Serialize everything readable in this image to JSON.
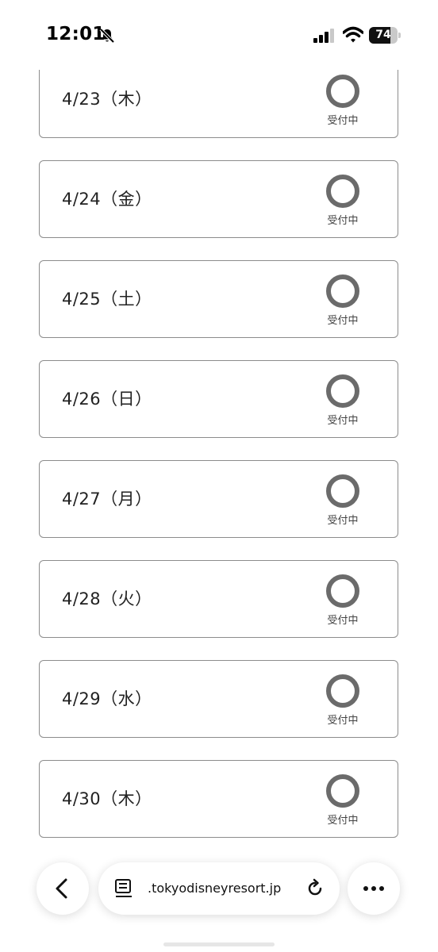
{
  "status_bar": {
    "time": "12:01",
    "battery_level": "74"
  },
  "days": [
    {
      "date": "4/23（木）",
      "status": "受付中"
    },
    {
      "date": "4/24（金）",
      "status": "受付中"
    },
    {
      "date": "4/25（土）",
      "status": "受付中"
    },
    {
      "date": "4/26（日）",
      "status": "受付中"
    },
    {
      "date": "4/27（月）",
      "status": "受付中"
    },
    {
      "date": "4/28（火）",
      "status": "受付中"
    },
    {
      "date": "4/29（水）",
      "status": "受付中"
    },
    {
      "date": "4/30（木）",
      "status": "受付中"
    }
  ],
  "browser": {
    "url": ".tokyodisneyresort.jp"
  },
  "colors": {
    "card_border": "#8c8c8c",
    "status_ring": "#6b6b6b"
  }
}
